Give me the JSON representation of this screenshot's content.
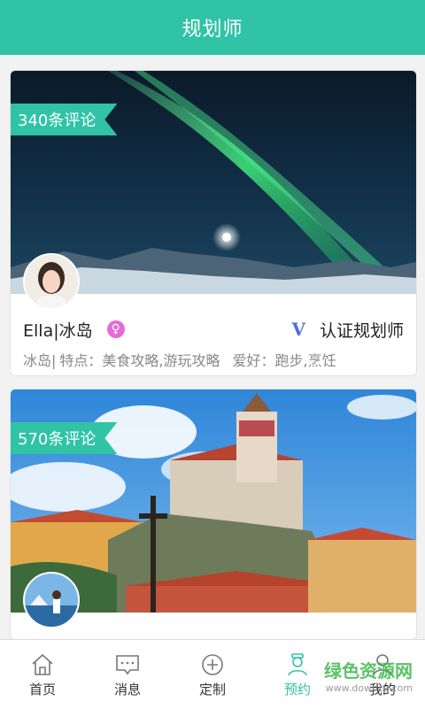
{
  "header": {
    "title": "规划师"
  },
  "cards": [
    {
      "review_badge": "340条评论",
      "name": "Ella|冰岛",
      "gender_symbol": "♀",
      "verified_mark": "V",
      "verified_label": "认证规划师",
      "location": "冰岛|",
      "features": "特点：美食攻略,游玩攻略",
      "hobbies": "爱好：跑步,烹饪"
    },
    {
      "review_badge": "570条评论"
    }
  ],
  "tabbar": {
    "items": [
      {
        "label": "首页",
        "icon": "home-icon"
      },
      {
        "label": "消息",
        "icon": "message-icon"
      },
      {
        "label": "定制",
        "icon": "plus-circle-icon"
      },
      {
        "label": "预约",
        "icon": "person-icon",
        "active": true
      },
      {
        "label": "我的",
        "icon": "profile-icon"
      }
    ]
  },
  "watermark": {
    "text": "绿色资源网",
    "sub": "www.downcc.com"
  },
  "colors": {
    "accent": "#30c3a6",
    "gender": "#e76ad9",
    "verified": "#4a6fe3"
  }
}
